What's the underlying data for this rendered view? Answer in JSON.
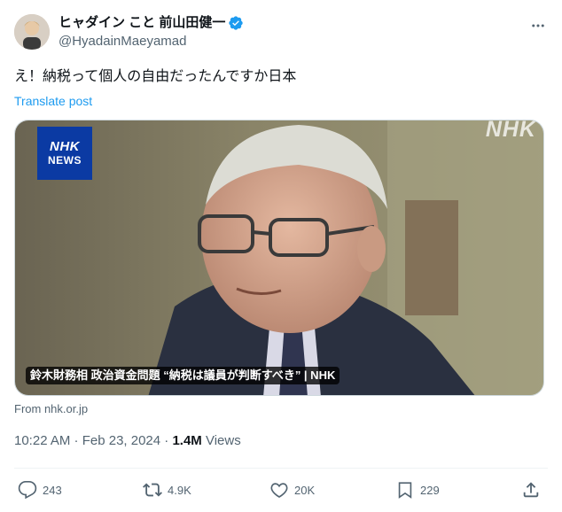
{
  "author": {
    "display_name": "ヒャダイン こと 前山田健一",
    "handle": "@HyadainMaeyamad",
    "verified_icon": "verified-badge-icon"
  },
  "tweet": {
    "text": "え！納税って個人の自由だったんですか日本",
    "translate_label": "Translate post"
  },
  "card": {
    "badge_line1": "NHK",
    "badge_line2": "NEWS",
    "watermark": "NHK",
    "caption": "鈴木財務相 政治資金問題 “納税は議員が判断すべき” | NHK",
    "source": "From nhk.or.jp"
  },
  "meta": {
    "time_date": "10:22 AM · Feb 23, 2024 · ",
    "views_count": "1.4M",
    "views_label": " Views"
  },
  "actions": {
    "replies": "243",
    "reposts": "4.9K",
    "likes": "20K",
    "bookmarks": "229"
  },
  "colors": {
    "accent": "#1d9bf0",
    "secondary_text": "#536471",
    "nhk_blue": "#0b3aa3"
  }
}
